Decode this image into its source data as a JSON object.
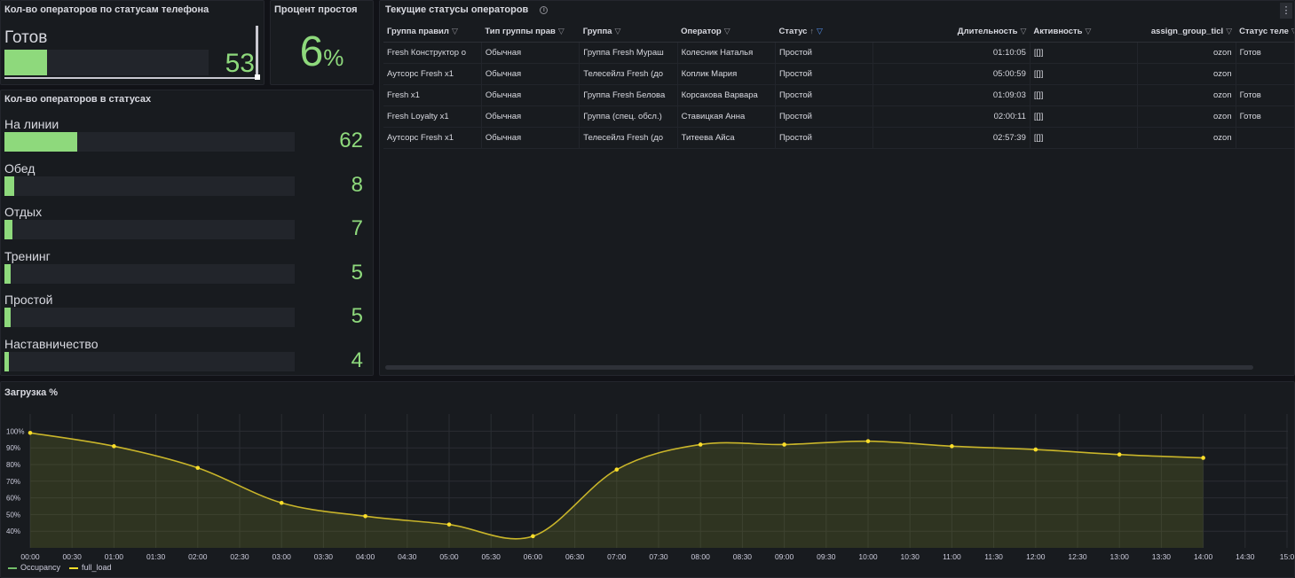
{
  "panel_phone": {
    "title": "Кол-во операторов по статусам телефона",
    "label": "Готов",
    "value": "53",
    "fill_fraction": 0.21
  },
  "panel_idle": {
    "title": "Процент простоя",
    "value": "6",
    "unit": "%"
  },
  "panel_status": {
    "title": "Кол-во операторов в статусах",
    "items": [
      {
        "label": "На линии",
        "value": "62",
        "fill_fraction": 0.25
      },
      {
        "label": "Обед",
        "value": "8",
        "fill_fraction": 0.033
      },
      {
        "label": "Отдых",
        "value": "7",
        "fill_fraction": 0.028
      },
      {
        "label": "Тренинг",
        "value": "5",
        "fill_fraction": 0.02
      },
      {
        "label": "Простой",
        "value": "5",
        "fill_fraction": 0.02
      },
      {
        "label": "Наставничество",
        "value": "4",
        "fill_fraction": 0.016
      }
    ]
  },
  "panel_table": {
    "title": "Текущие статусы операторов",
    "info_icon": "info-icon",
    "menu_icon": "kebab-menu-icon",
    "columns": [
      "Группа правил",
      "Тип группы прав",
      "Группа",
      "Оператор",
      "Статус",
      "Длительность",
      "Активность",
      "assign_group_ticl",
      "Статус теле"
    ],
    "rows": [
      [
        "Fresh Конструктор о",
        "Обычная",
        "Группа Fresh Мураш",
        "Колесник Наталья",
        "Простой",
        "01:10:05",
        "[[]]",
        "ozon",
        "Готов"
      ],
      [
        "Аутсорс Fresh x1",
        "Обычная",
        "Телесейлз Fresh (до",
        "Коплик Мария",
        "Простой",
        "05:00:59",
        "[[]]",
        "ozon",
        ""
      ],
      [
        "Fresh x1",
        "Обычная",
        "Группа Fresh Белова",
        "Корсакова Варвара",
        "Простой",
        "01:09:03",
        "[[]]",
        "ozon",
        "Готов"
      ],
      [
        "Fresh Loyalty x1",
        "Обычная",
        "Группа (спец. обсл.)",
        "Ставицкая Анна",
        "Простой",
        "02:00:11",
        "[[]]",
        "ozon",
        "Готов"
      ],
      [
        "Аутсорс Fresh x1",
        "Обычная",
        "Телесейлз Fresh (до",
        "Титеева Айса",
        "Простой",
        "02:57:39",
        "[[]]",
        "ozon",
        ""
      ]
    ]
  },
  "panel_chart": {
    "title": "Загрузка %"
  },
  "chart_data": {
    "type": "line",
    "title": "Загрузка %",
    "xlabel": "",
    "ylabel": "",
    "x_ticks": [
      "00:00",
      "00:30",
      "01:00",
      "01:30",
      "02:00",
      "02:30",
      "03:00",
      "03:30",
      "04:00",
      "04:30",
      "05:00",
      "05:30",
      "06:00",
      "06:30",
      "07:00",
      "07:30",
      "08:00",
      "08:30",
      "09:00",
      "09:30",
      "10:00",
      "10:30",
      "11:00",
      "11:30",
      "12:00",
      "12:30",
      "13:00",
      "13:30",
      "14:00",
      "14:30",
      "15:0"
    ],
    "y_ticks": [
      "100%",
      "90%",
      "80%",
      "70%",
      "60%",
      "50%",
      "40%"
    ],
    "ylim": [
      30,
      105
    ],
    "x_hours": [
      0,
      1,
      2,
      3,
      4,
      5,
      6,
      7,
      8,
      9,
      10,
      11,
      12,
      13,
      14
    ],
    "series": [
      {
        "name": "Occupancy",
        "color": "#73bf69",
        "values": []
      },
      {
        "name": "full_load",
        "color": "#fade2a",
        "values": [
          99,
          91,
          78,
          57,
          49,
          44,
          37,
          77,
          92,
          92,
          94,
          91,
          89,
          86,
          84
        ]
      }
    ],
    "legend_position": "bottom-left",
    "grid": true
  }
}
